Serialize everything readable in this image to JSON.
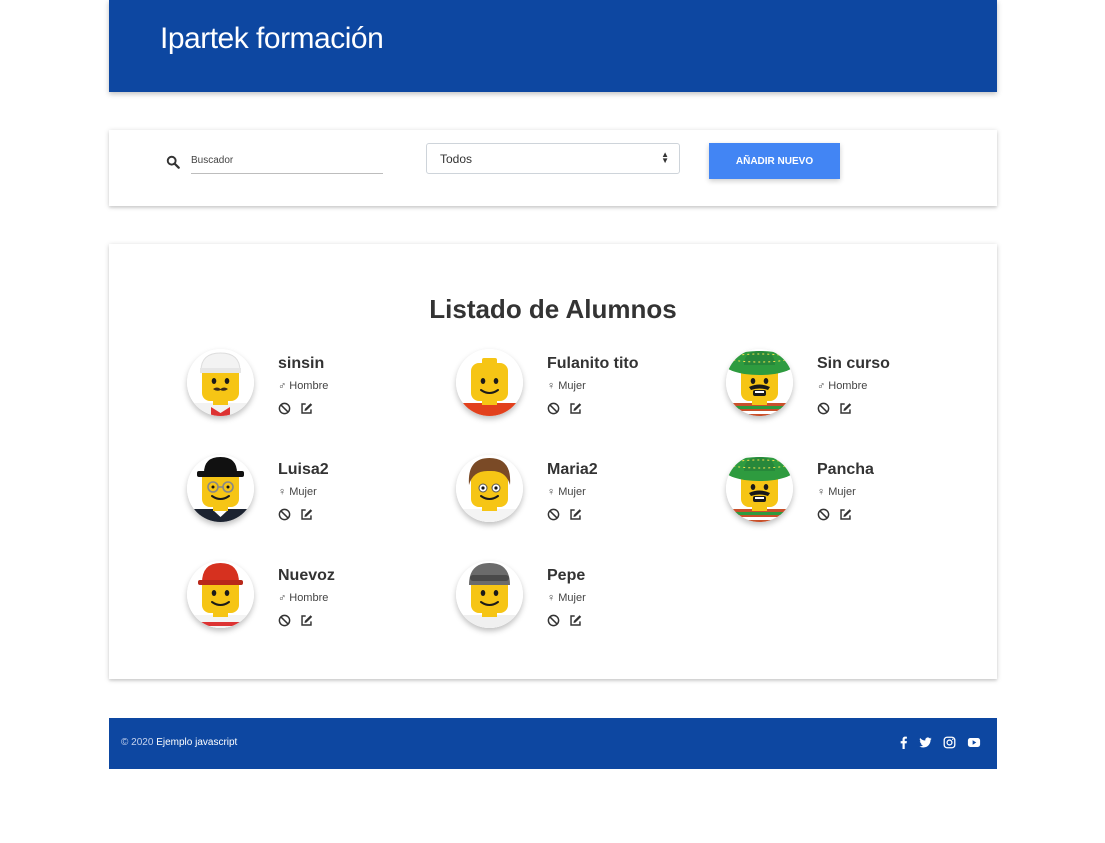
{
  "header": {
    "brand": "Ipartek formación",
    "color": "#0d47a1"
  },
  "toolbar": {
    "search_placeholder": "Buscador",
    "search_value": "",
    "filter_selected": "Todos",
    "add_button": "AÑADIR NUEVO",
    "button_color": "#4285f4"
  },
  "list": {
    "title": "Listado de Alumnos",
    "students": [
      {
        "name": "sinsin",
        "gender": "Hombre",
        "gender_icon": "mars-icon",
        "avatar": "lego-white-cap"
      },
      {
        "name": "Fulanito tito",
        "gender": "Mujer",
        "gender_icon": "venus-icon",
        "avatar": "lego-red-shirt"
      },
      {
        "name": "Sin curso",
        "gender": "Hombre",
        "gender_icon": "mars-icon",
        "avatar": "lego-sombrero"
      },
      {
        "name": "Luisa2",
        "gender": "Mujer",
        "gender_icon": "venus-icon",
        "avatar": "lego-bowler-glasses"
      },
      {
        "name": "Maria2",
        "gender": "Mujer",
        "gender_icon": "venus-icon",
        "avatar": "lego-brown-hair"
      },
      {
        "name": "Pancha",
        "gender": "Mujer",
        "gender_icon": "venus-icon",
        "avatar": "lego-sombrero"
      },
      {
        "name": "Nuevoz",
        "gender": "Hombre",
        "gender_icon": "mars-icon",
        "avatar": "lego-hardhat"
      },
      {
        "name": "Pepe",
        "gender": "Mujer",
        "gender_icon": "venus-icon",
        "avatar": "lego-grey-helmet"
      }
    ]
  },
  "footer": {
    "copyright": "© 2020",
    "link": "Ejemplo javascript",
    "socials": [
      "facebook-icon",
      "twitter-icon",
      "instagram-icon",
      "youtube-icon"
    ]
  }
}
